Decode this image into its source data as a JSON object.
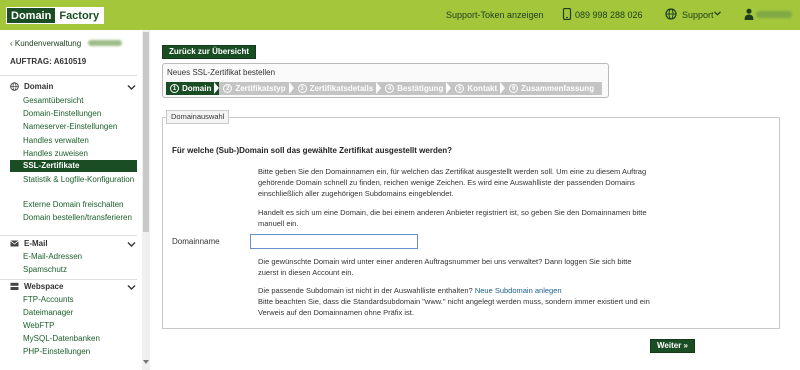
{
  "header": {
    "logo_left": "Domain",
    "logo_right": "Factory",
    "support_token": "Support-Token anzeigen",
    "phone": "089 998 288 026",
    "support_menu": "Support"
  },
  "sidebar": {
    "back_link": "‹ Kundenverwaltung",
    "auftrag": "AUFTRAG: A610519",
    "sections": [
      {
        "title": "Domain",
        "items": [
          "Gesamtübersicht",
          "Domain-Einstellungen",
          "Nameserver-Einstellungen",
          "Handles verwalten",
          "Handles zuweisen",
          "SSL-Zertifikate",
          "Statistik & Logfile-Konfiguration",
          "Externe Domain freischalten",
          "Domain bestellen/transferieren"
        ]
      },
      {
        "title": "E-Mail",
        "items": [
          "E-Mail-Adressen",
          "Spamschutz"
        ]
      },
      {
        "title": "Webspace",
        "items": [
          "FTP-Accounts",
          "Dateimanager",
          "WebFTP",
          "MySQL-Datenbanken",
          "PHP-Einstellungen"
        ]
      }
    ],
    "active_item": "SSL-Zertifikate"
  },
  "main": {
    "back_button": "Zurück zur Übersicht",
    "wizard_title": "Neues SSL-Zertifikat bestellen",
    "steps": [
      {
        "num": "1",
        "label": "Domain"
      },
      {
        "num": "2",
        "label": "Zertifikatstyp"
      },
      {
        "num": "3",
        "label": "Zertifikatsdetails"
      },
      {
        "num": "4",
        "label": "Bestätigung"
      },
      {
        "num": "5",
        "label": "Kontakt"
      },
      {
        "num": "6",
        "label": "Zusammenfassung"
      }
    ],
    "panel_title": "Domainauswahl",
    "question": "Für welche (Sub-)Domain soll das gewählte Zertifikat ausgestellt werden?",
    "para1": "Bitte geben Sie den Domainnamen ein, für welchen das Zertifikat ausgestellt werden soll. Um eine zu diesem Auftrag gehörende Domain schnell zu finden, reichen wenige Zeichen. Es wird eine Auswahlliste der passenden Domains einschließlich aller zugehörigen Subdomains eingeblendet.",
    "para2": "Handelt es sich um eine Domain, die bei einem anderen Anbieter registriert ist, so geben Sie den Domainnamen bitte manuell ein.",
    "domain_label": "Domainname",
    "domain_value": "",
    "para3": "Die gewünschte Domain wird unter einer anderen Auftragsnummer bei uns verwaltet? Dann loggen Sie sich bitte zuerst in diesen Account ein.",
    "para4_prefix": "Die passende Subdomain ist nicht in der Auswahlliste enthalten?",
    "para4_link": "Neue Subdomain anlegen",
    "para4_rest": "Bitte beachten Sie, dass die Standardsubdomain \"www.\" nicht angelegt werden muss, sondern immer existiert und ein Verweis auf den Domainnamen ohne Präfix ist.",
    "next_button": "Weiter »"
  }
}
